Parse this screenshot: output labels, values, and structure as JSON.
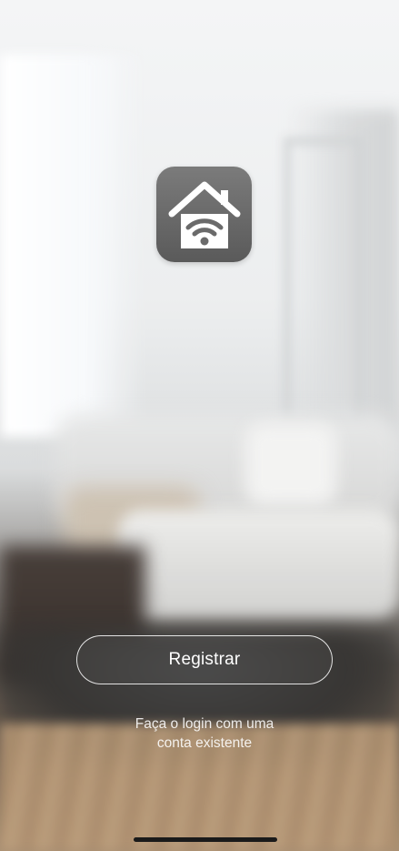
{
  "app": {
    "logo_icon": "smart-home-wifi-icon",
    "logo_color": "#6a6a6a"
  },
  "actions": {
    "register_label": "Registrar",
    "login_line1": "Faça o login com uma",
    "login_line2": "conta existente"
  },
  "background": {
    "description_icon": "living-room-background"
  }
}
